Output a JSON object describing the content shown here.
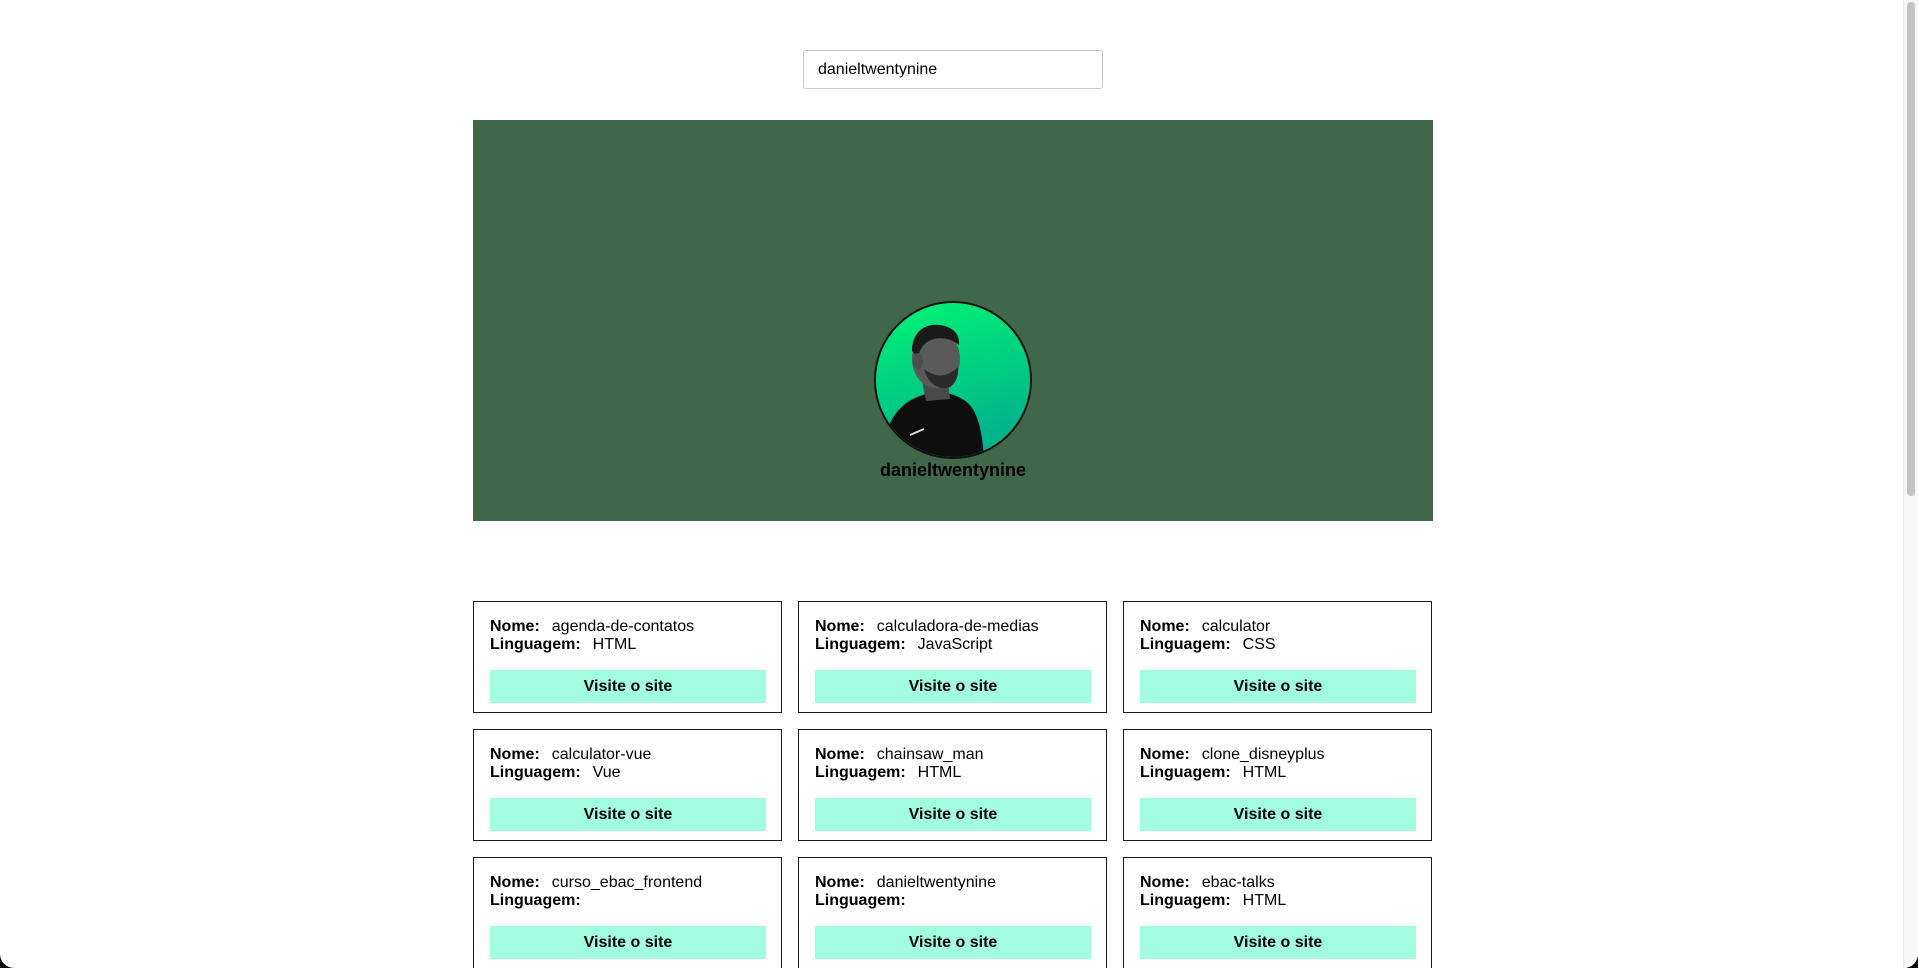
{
  "search": {
    "value": "danieltwentynine"
  },
  "profile": {
    "name": "danieltwentynine",
    "banner_color": "#41674b"
  },
  "repo_labels": {
    "name_label": "Nome:",
    "language_label": "Linguagem:",
    "visit_button": "Visite o site"
  },
  "repos": [
    {
      "name": "agenda-de-contatos",
      "language": "HTML"
    },
    {
      "name": "calculadora-de-medias",
      "language": "JavaScript"
    },
    {
      "name": "calculator",
      "language": "CSS"
    },
    {
      "name": "calculator-vue",
      "language": "Vue"
    },
    {
      "name": "chainsaw_man",
      "language": "HTML"
    },
    {
      "name": "clone_disneyplus",
      "language": "HTML"
    },
    {
      "name": "curso_ebac_frontend",
      "language": ""
    },
    {
      "name": "danieltwentynine",
      "language": ""
    },
    {
      "name": "ebac-talks",
      "language": "HTML"
    }
  ],
  "colors": {
    "button_bg": "#a3fde0",
    "card_border": "#1a1a1a",
    "avatar_gradient_top": "#00f575",
    "avatar_gradient_bottom": "#00b38a"
  }
}
